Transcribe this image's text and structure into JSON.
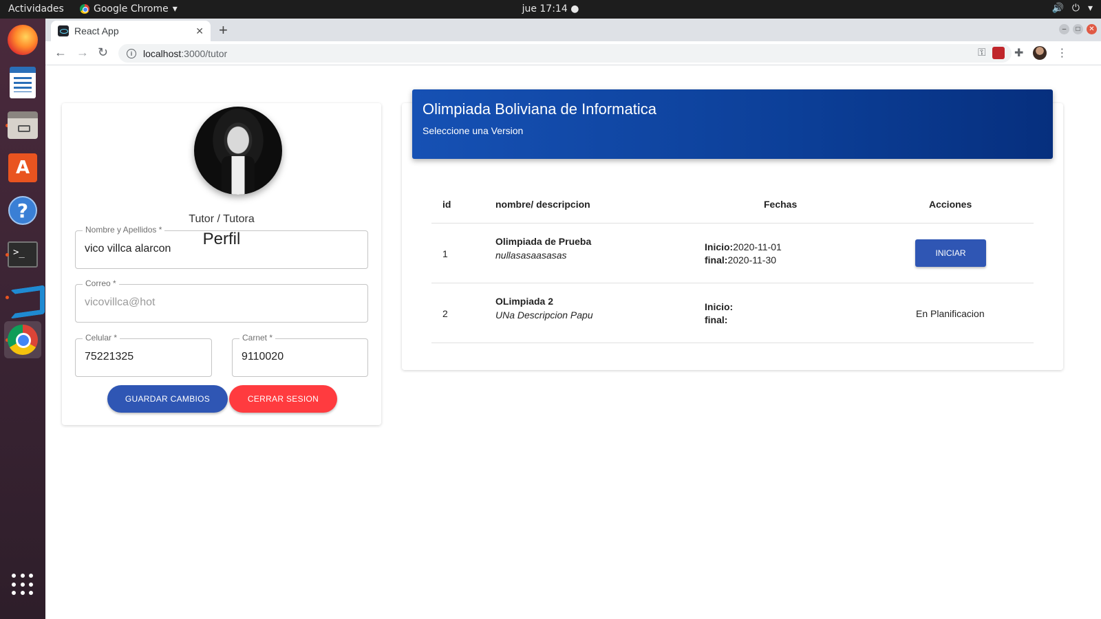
{
  "os": {
    "activities": "Actividades",
    "app_name": "Google Chrome",
    "clock": "jue 17:14"
  },
  "browser": {
    "tab_title": "React App",
    "url_host": "localhost",
    "url_path": ":3000/tutor"
  },
  "profile": {
    "role": "Tutor / Tutora",
    "title": "Perfil",
    "fields": {
      "name": {
        "label": "Nombre y Apellidos *",
        "value": "vico villca alarcon"
      },
      "email": {
        "label": "Correo *",
        "value": "vicovillca@hot"
      },
      "phone": {
        "label": "Celular *",
        "value": "75221325"
      },
      "carnet": {
        "label": "Carnet *",
        "value": "9110020"
      }
    },
    "save_label": "GUARDAR CAMBIOS",
    "logout_label": "CERRAR SESION"
  },
  "olimpiadas": {
    "title": "Olimpiada Boliviana de Informatica",
    "subtitle": "Seleccione una Version",
    "headers": {
      "id": "id",
      "name": "nombre/ descripcion",
      "dates": "Fechas",
      "actions": "Acciones"
    },
    "start_label": "Inicio:",
    "end_label": "final:",
    "rows": [
      {
        "id": "1",
        "name": "Olimpiada de Prueba",
        "desc": "nullasasaasasas",
        "start": "2020-11-01",
        "end": "2020-11-30",
        "action": "INICIAR"
      },
      {
        "id": "2",
        "name": "OLimpiada 2",
        "desc": "UNa Descripcion Papu",
        "start": "",
        "end": "",
        "action": "En Planificacion"
      }
    ]
  },
  "colors": {
    "primary": "#2f56b4",
    "danger": "#ff3b3f",
    "banner_start": "#1651b4",
    "banner_end": "#062f7e"
  }
}
